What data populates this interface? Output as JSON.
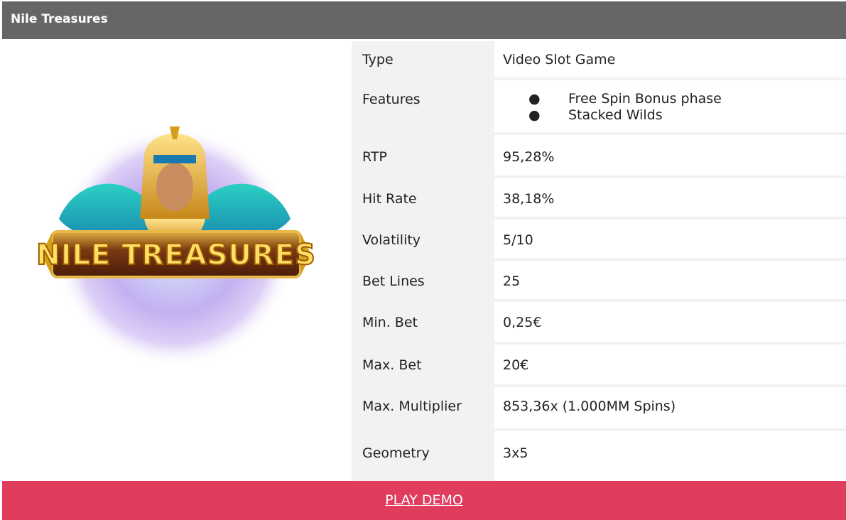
{
  "header": {
    "title": "Nile Treasures"
  },
  "logo": {
    "text": "NILE TREASURES",
    "alt_name": "nile-treasures-logo"
  },
  "details": [
    {
      "label": "Type",
      "value": "Video Slot Game"
    },
    {
      "label": "Features",
      "features": [
        "Free Spin Bonus phase",
        "Stacked Wilds"
      ]
    },
    {
      "label": "RTP",
      "value": "95,28%"
    },
    {
      "label": "Hit Rate",
      "value": "38,18%"
    },
    {
      "label": "Volatility",
      "value": "5/10"
    },
    {
      "label": "Bet Lines",
      "value": "25"
    },
    {
      "label": "Min. Bet",
      "value": "0,25€"
    },
    {
      "label": "Max. Bet",
      "value": "20€"
    },
    {
      "label": "Max. Multiplier",
      "value": "853,36x (1.000MM Spins)"
    },
    {
      "label": "Geometry",
      "value": "3x5"
    }
  ],
  "bullet_symbol": "●",
  "cta": {
    "label": "PLAY DEMO"
  },
  "colors": {
    "header_bg": "#666666",
    "label_bg": "#f2f2f2",
    "cta_bg": "#e03c5e"
  }
}
